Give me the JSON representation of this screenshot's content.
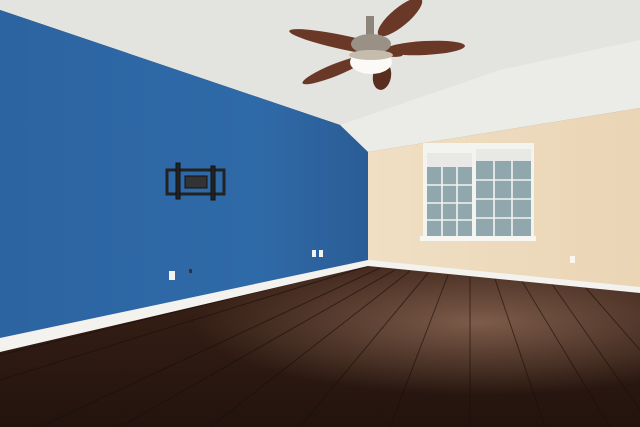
{
  "scene": {
    "description_label": "",
    "colors": {
      "accent_wall": "#2f6aa8",
      "accent_wall_shadow": "#25578d",
      "cream_wall": "#efdcc0",
      "ceiling": "#e6e6e2",
      "floor_dark": "#2a1812",
      "floor_mid": "#4a2a1c",
      "baseboard": "#f4f2ee",
      "fan_blade": "#6a3826",
      "window_frame": "#f3f3f0",
      "window_glass": "#8fa7ad"
    },
    "objects": [
      {
        "name": "ceiling-fan",
        "icon": "fan-icon"
      },
      {
        "name": "tv-wall-mount",
        "icon": "bracket-icon"
      },
      {
        "name": "window",
        "icon": "window-icon"
      },
      {
        "name": "outlets",
        "icon": "outlet-icon"
      }
    ]
  }
}
